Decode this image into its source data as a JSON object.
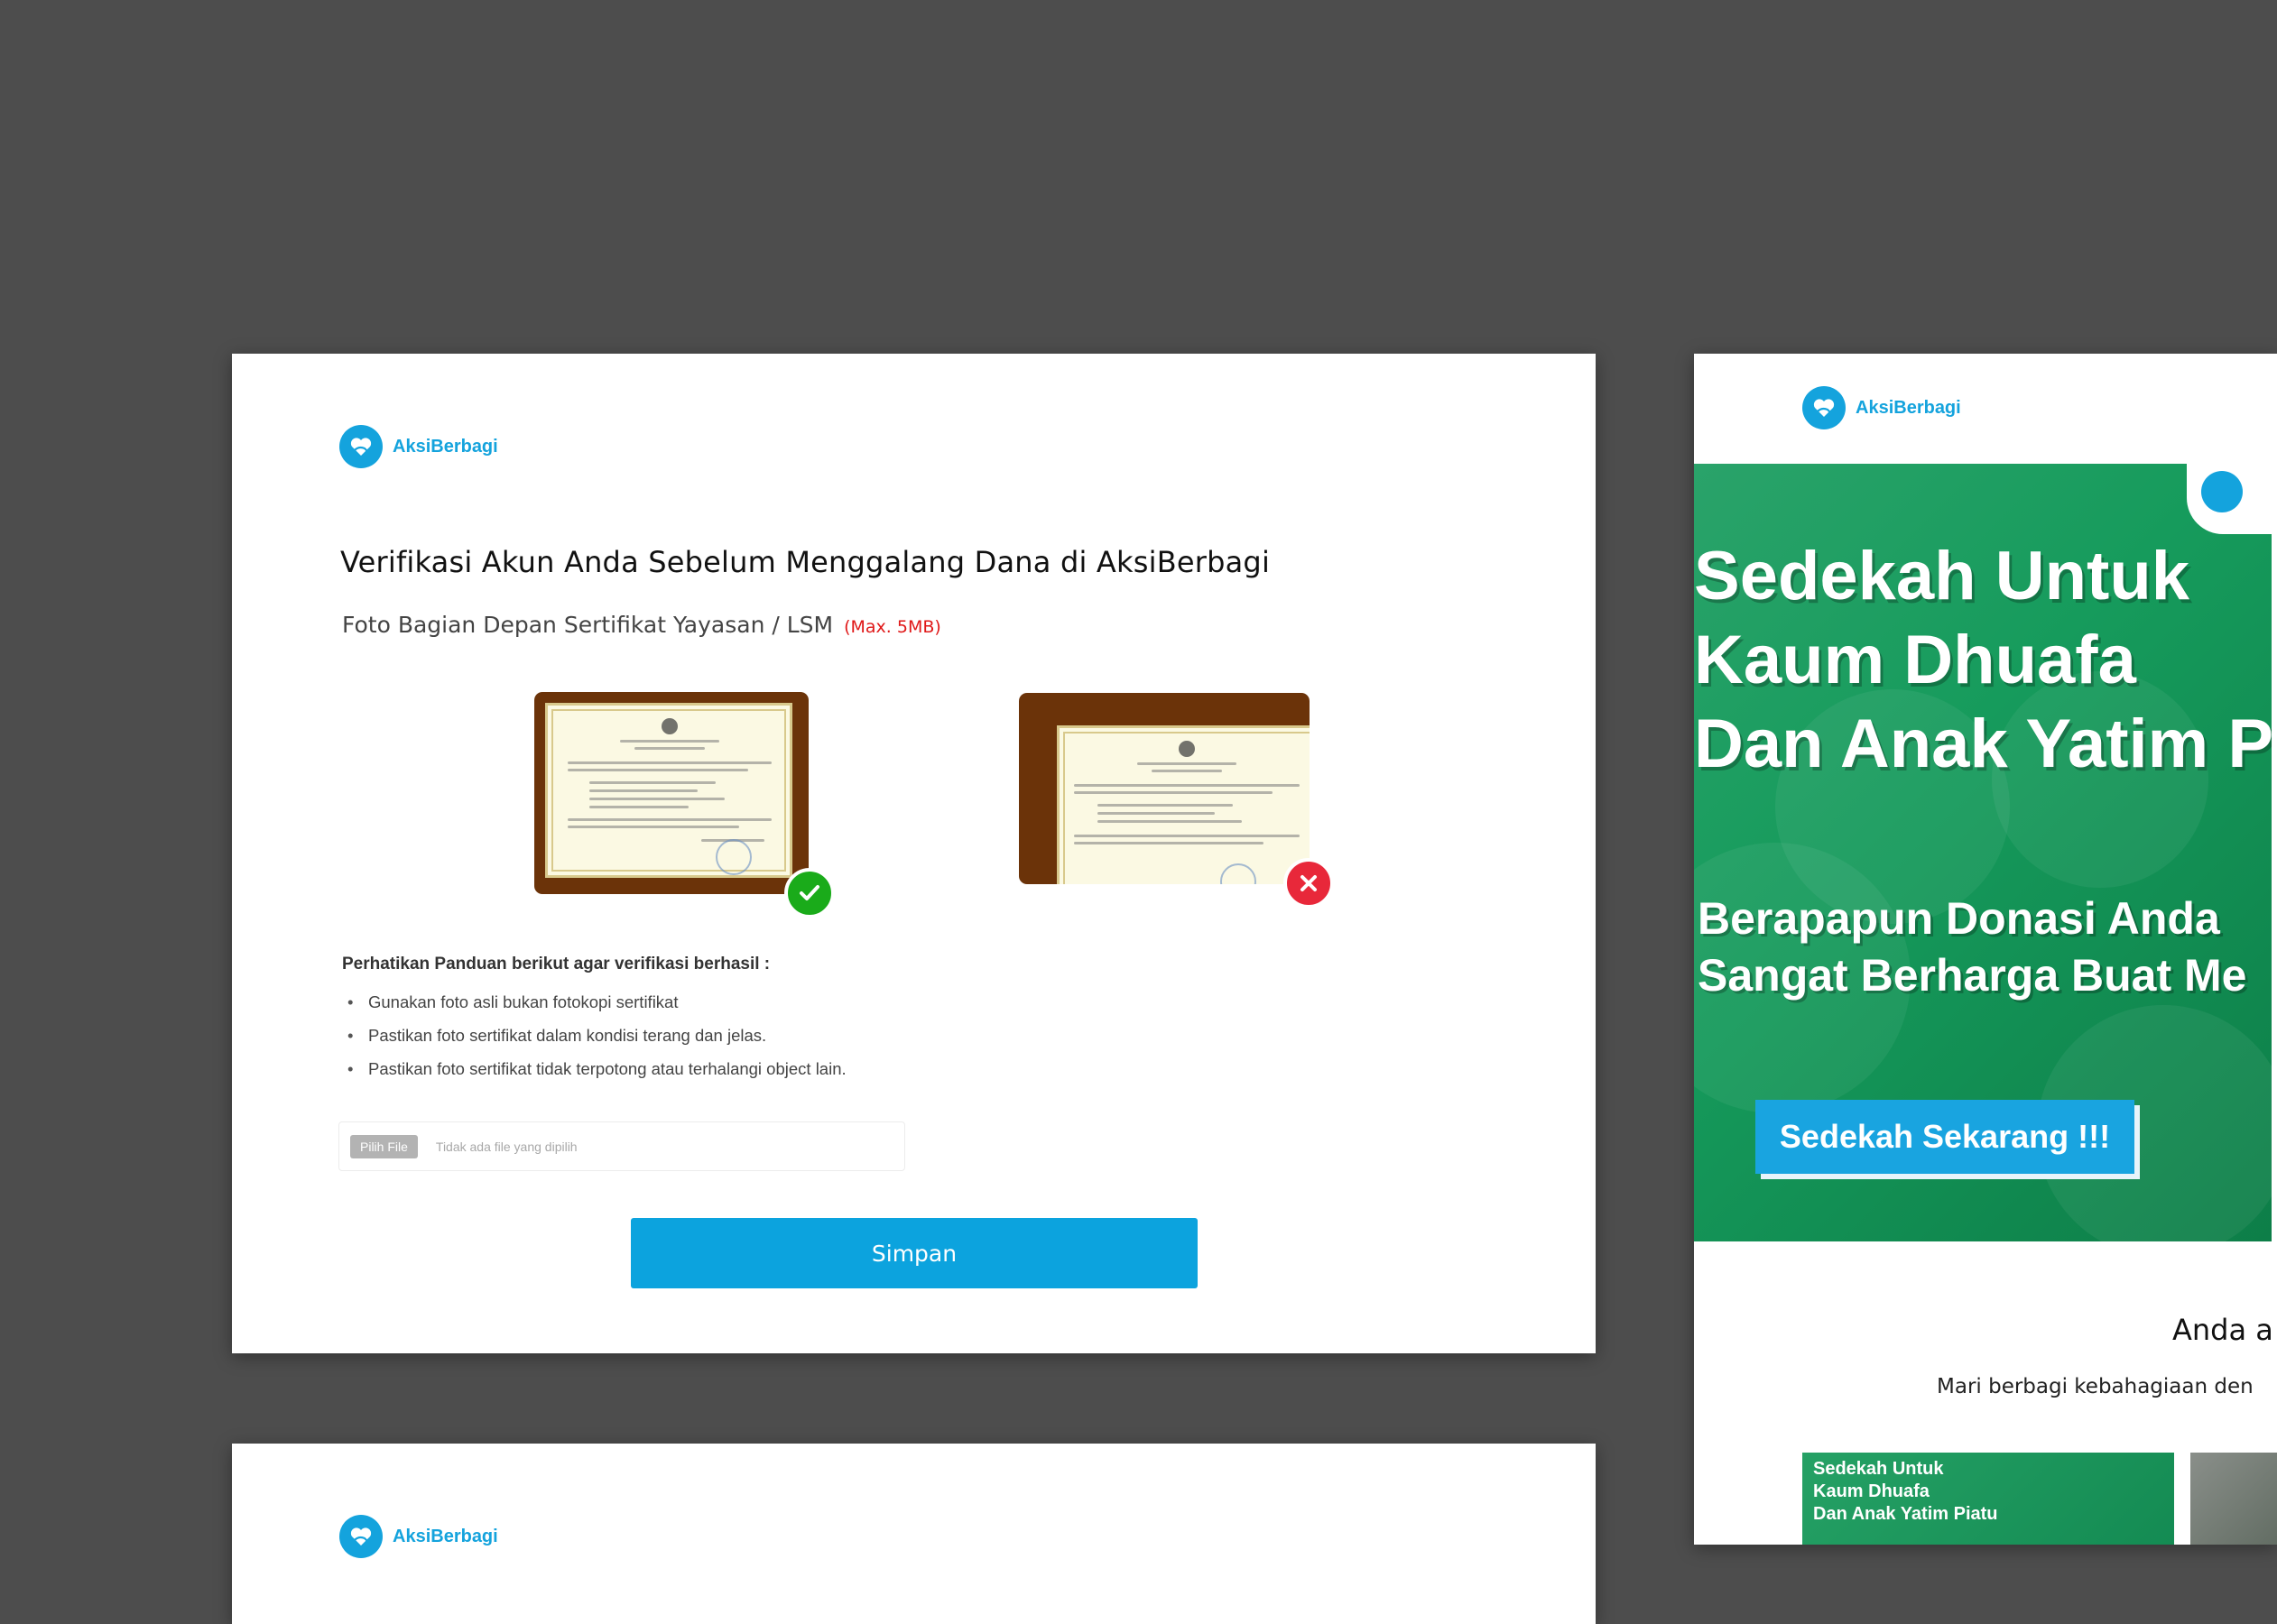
{
  "brand": {
    "name": "AksiBerbagi",
    "logo_icon": "heart-hand-icon",
    "color": "#14a3dd"
  },
  "verification": {
    "title": "Verifikasi Akun Anda Sebelum Menggalang Dana di AksiBerbagi",
    "field_label": "Foto Bagian Depan Sertifikat Yayasan / LSM",
    "max_size": "(Max. 5MB)",
    "examples": [
      {
        "status": "correct",
        "icon": "check-icon",
        "color": "#1aab1a"
      },
      {
        "status": "incorrect",
        "icon": "cross-icon",
        "color": "#e8283a"
      }
    ],
    "guide_title": "Perhatikan Panduan berikut agar verifikasi berhasil :",
    "guide_items": [
      "Gunakan foto asli bukan fotokopi sertifikat",
      "Pastikan foto sertifikat dalam kondisi terang dan jelas.",
      "Pastikan foto sertifikat tidak terpotong atau terhalangi object lain."
    ],
    "file_button": "Pilih File",
    "file_status": "Tidak ada file yang dipilih",
    "save_button": "Simpan"
  },
  "promo": {
    "headline_1": "Sedekah Untuk",
    "headline_2": "Kaum Dhuafa",
    "headline_3": "Dan Anak Yatim P",
    "sub_1": "Berapapun Donasi Anda",
    "sub_2": "Sangat Berharga Buat Me",
    "cta": "Sedekah Sekarang !!!",
    "section_heading": "Anda a",
    "section_desc": "Mari berbagi kebahagiaan den",
    "thumb_1": "Sedekah Untuk",
    "thumb_2": "Kaum Dhuafa",
    "thumb_3": "Dan Anak Yatim Piatu"
  }
}
